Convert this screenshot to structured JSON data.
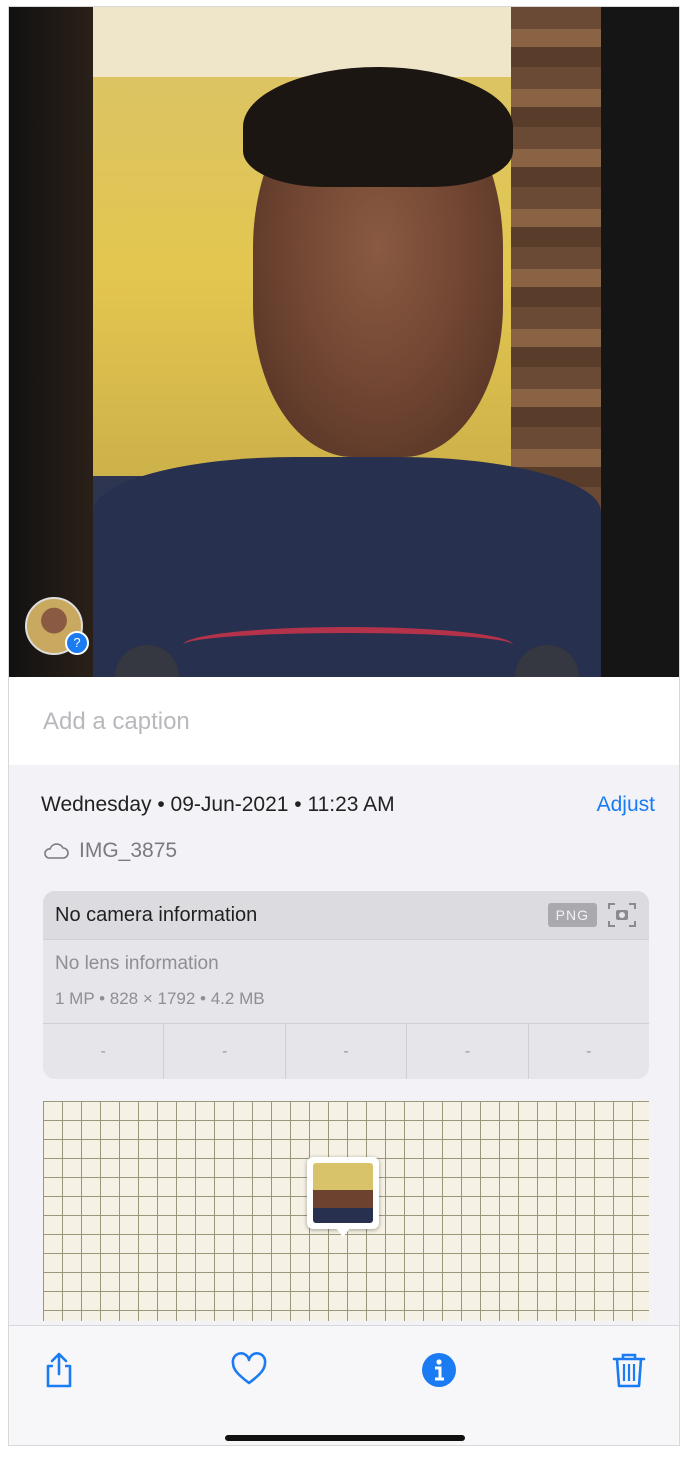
{
  "caption": {
    "placeholder": "Add a caption"
  },
  "info": {
    "date_line": "Wednesday • 09-Jun-2021 • 11:23 AM",
    "adjust_label": "Adjust",
    "filename": "IMG_3875"
  },
  "camera_card": {
    "title": "No camera information",
    "format_badge": "PNG",
    "lens": "No lens information",
    "specs": "1 MP • 828 × 1792 • 4.2 MB",
    "exif": [
      "-",
      "-",
      "-",
      "-",
      "-"
    ]
  },
  "toolbar": {
    "icons": [
      "share-icon",
      "heart-icon",
      "info-icon",
      "trash-icon"
    ]
  },
  "colors": {
    "accent": "#1a7bf2"
  }
}
